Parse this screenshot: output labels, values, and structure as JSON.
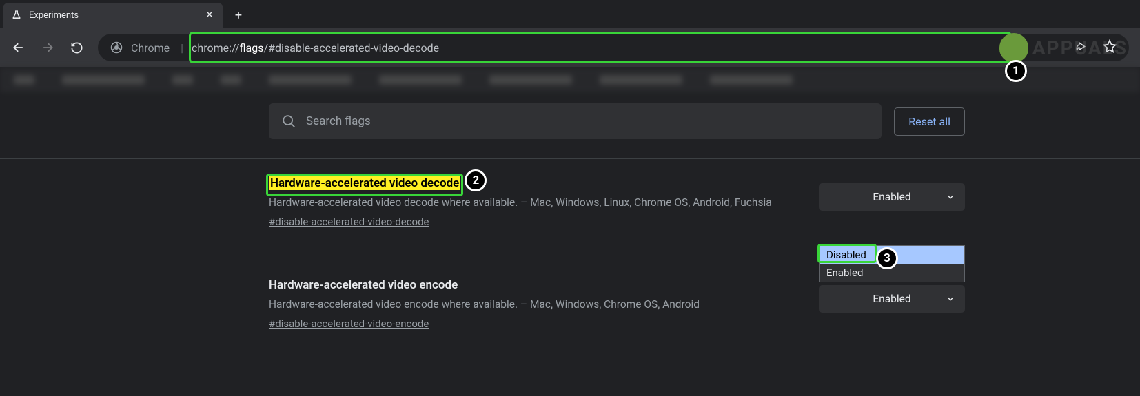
{
  "tab": {
    "title": "Experiments"
  },
  "toolbar": {
    "chrome_label": "Chrome",
    "url_prefix": "chrome://",
    "url_highlight": "flags",
    "url_suffix": "/#disable-accelerated-video-decode"
  },
  "search": {
    "placeholder": "Search flags"
  },
  "reset": {
    "label": "Reset all"
  },
  "flags": [
    {
      "title": "Hardware-accelerated video decode",
      "description": "Hardware-accelerated video decode where available. – Mac, Windows, Linux, Chrome OS, Android, Fuchsia",
      "hash": "#disable-accelerated-video-decode",
      "selected": "Enabled",
      "options": [
        "Disabled",
        "Enabled"
      ]
    },
    {
      "title": "Hardware-accelerated video encode",
      "description": "Hardware-accelerated video encode where available. – Mac, Windows, Chrome OS, Android",
      "hash": "#disable-accelerated-video-encode",
      "selected": "Enabled"
    }
  ],
  "annotations": {
    "1": "1",
    "2": "2",
    "3": "3"
  },
  "watermark": "APPUALS"
}
